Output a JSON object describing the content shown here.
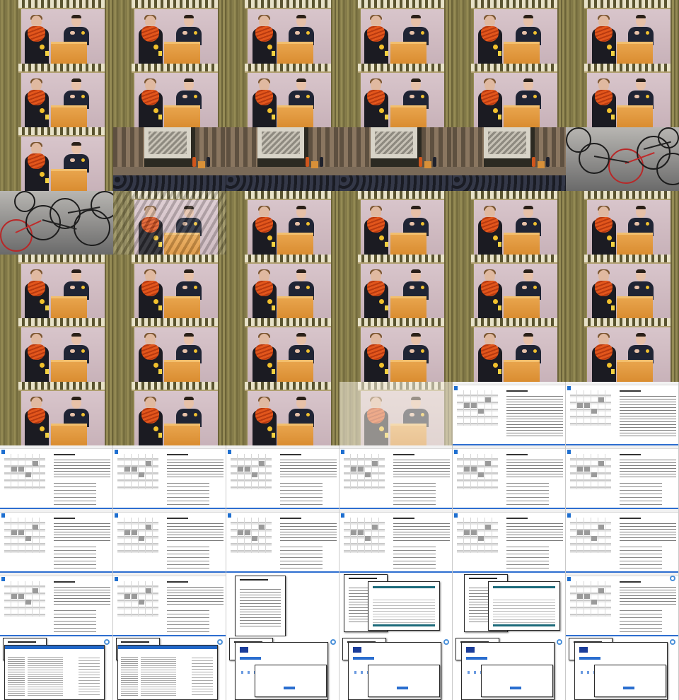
{
  "grid": {
    "columns": 6,
    "rows": 11
  },
  "frames": [
    "speaker",
    "speaker",
    "speaker",
    "speaker",
    "speaker",
    "speaker",
    "speaker",
    "speaker",
    "speaker",
    "speaker",
    "speaker",
    "speaker",
    "speaker",
    "hall",
    "hall",
    "hall",
    "hall",
    "bicycles",
    "bicycles",
    "speaker-bicycles",
    "speaker",
    "speaker",
    "speaker",
    "speaker",
    "speaker",
    "speaker",
    "speaker",
    "speaker",
    "speaker",
    "speaker",
    "speaker",
    "speaker",
    "speaker",
    "speaker",
    "speaker",
    "speaker",
    "speaker",
    "speaker",
    "speaker",
    "speaker-document",
    "document",
    "document",
    "document",
    "document",
    "document",
    "document",
    "document",
    "document",
    "document",
    "document",
    "document",
    "document",
    "document",
    "document",
    "document",
    "document",
    "article-window",
    "table-window",
    "table-window",
    "document",
    "list-window",
    "list-window",
    "form-window",
    "form-window",
    "form-window",
    "form-window"
  ],
  "colors": {
    "scarf": "#e2561c",
    "podium": "#d88a2e",
    "wall": "#d2bdc3",
    "curtain": "#8a8150",
    "document": "#ffffff",
    "link_blue": "#2a6ecf",
    "teal": "#1c6a7a"
  }
}
